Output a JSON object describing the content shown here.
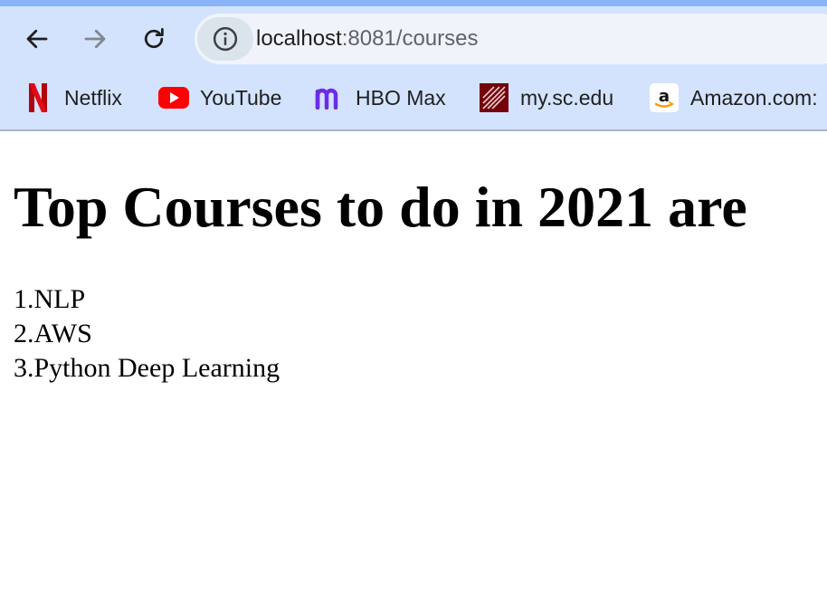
{
  "browser": {
    "address": {
      "host": "localhost",
      "rest": ":8081/courses"
    },
    "bookmarks": [
      {
        "label": "Netflix",
        "icon": "netflix-icon"
      },
      {
        "label": "YouTube",
        "icon": "youtube-icon"
      },
      {
        "label": "HBO Max",
        "icon": "hbo-max-icon"
      },
      {
        "label": "my.sc.edu",
        "icon": "my-sc-edu-icon"
      },
      {
        "label": "Amazon.com:",
        "icon": "amazon-icon"
      }
    ],
    "colors": {
      "chrome": "#d3e3fd",
      "omnibox": "#f0f4fa",
      "accent": "#8ab4f8"
    }
  },
  "page": {
    "heading": "Top Courses to do in 2021 are",
    "courses": [
      "1.NLP",
      "2.AWS",
      "3.Python Deep Learning"
    ]
  }
}
